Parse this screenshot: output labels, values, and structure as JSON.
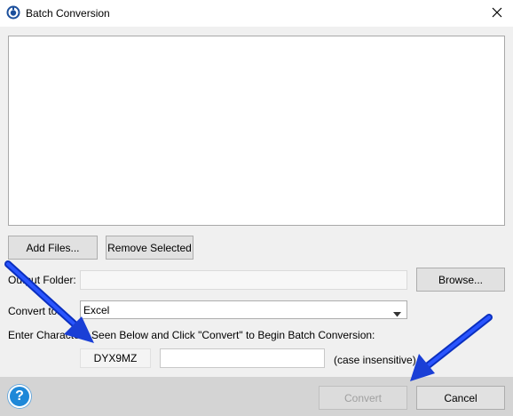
{
  "window": {
    "title": "Batch Conversion",
    "icon": "app-logo-icon"
  },
  "buttons": {
    "add_files": "Add Files...",
    "remove_selected": "Remove Selected",
    "browse": "Browse...",
    "convert": "Convert",
    "cancel": "Cancel"
  },
  "output_folder": {
    "label": "Output Folder:",
    "value": ""
  },
  "convert_to": {
    "label": "Convert to:",
    "selected": "Excel"
  },
  "captcha": {
    "instruction": "Enter Characters Seen Below and Click \"Convert\" to Begin Batch Conversion:",
    "code": "DYX9MZ",
    "input_value": "",
    "note": "(case insensitive)"
  },
  "help": {
    "glyph": "?"
  },
  "colors": {
    "annotation_arrow": "#1a3fd6",
    "help_blue": "#1e88d8"
  }
}
